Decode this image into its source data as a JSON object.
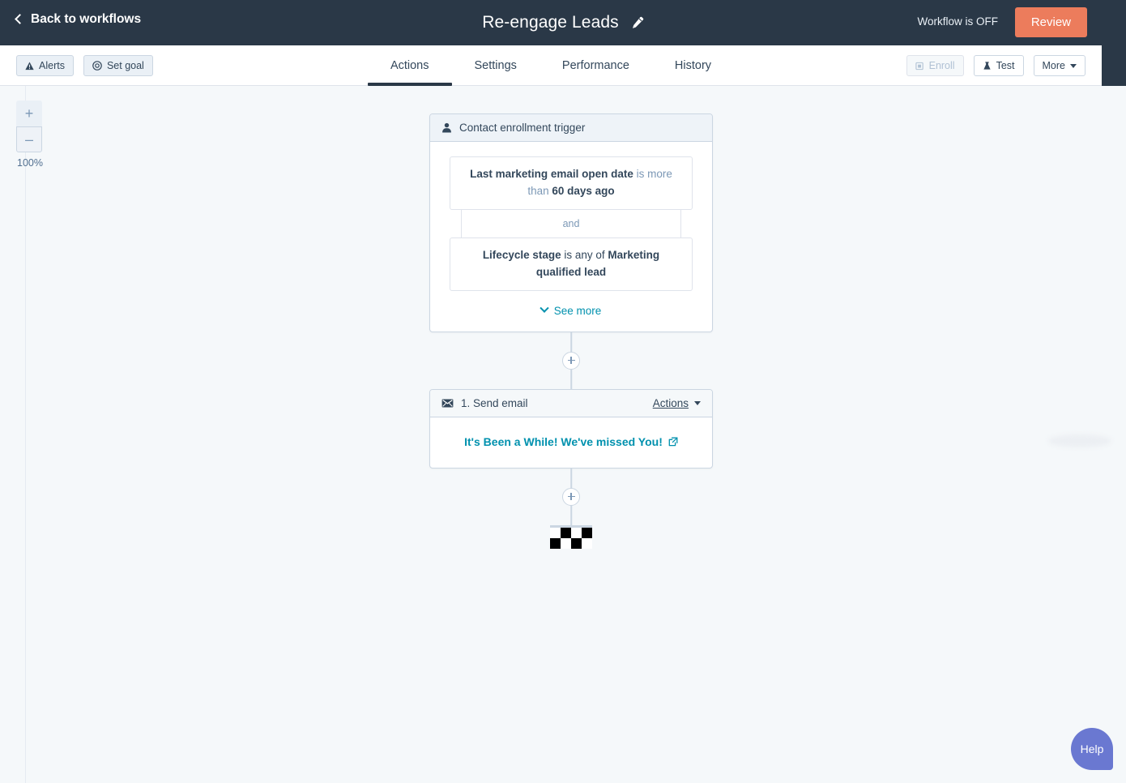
{
  "header": {
    "back_label": "Back to workflows",
    "back_icon": "chevron-left-icon",
    "title": "Re-engage Leads",
    "edit_icon": "pencil-icon",
    "workflow_state": "Workflow is OFF",
    "review_label": "Review",
    "review_color": "#ec7c5c",
    "bar_color": "#2a3847"
  },
  "toolbar": {
    "alerts_label": "Alerts",
    "alerts_icon": "warning-triangle-icon",
    "set_goal_label": "Set goal",
    "set_goal_icon": "target-icon",
    "enroll_label": "Enroll",
    "enroll_icon": "enroll-icon",
    "enroll_disabled": "true",
    "test_label": "Test",
    "test_icon": "flask-icon",
    "more_label": "More",
    "more_icon": "caret-down-icon"
  },
  "tabs": [
    {
      "label": "Actions",
      "active": true
    },
    {
      "label": "Settings",
      "active": false
    },
    {
      "label": "Performance",
      "active": false
    },
    {
      "label": "History",
      "active": false
    }
  ],
  "zoom": {
    "in_label": "+",
    "out_label": "–",
    "level": "100%"
  },
  "flow": {
    "trigger": {
      "icon": "contact-person-icon",
      "title": "Contact enrollment trigger",
      "filters": [
        {
          "property": "Last marketing email open date",
          "operator": " is more than ",
          "value": "60 days ago"
        },
        {
          "property": "Lifecycle stage",
          "operator": " is any of ",
          "value": "Marketing qualified lead"
        }
      ],
      "join_label": "and",
      "see_more_label": "See more",
      "see_more_icon": "chevron-down-icon"
    },
    "add_step_icon": "plus-circle-icon",
    "action": {
      "icon": "envelope-icon",
      "title": "1. Send email",
      "actions_label": "Actions",
      "actions_caret_icon": "caret-down-icon",
      "email_name": "It's Been a While! We've missed You!",
      "email_external_icon": "external-link-icon"
    },
    "end_marker": "checkered-flag-icon"
  },
  "help": {
    "label": "Help",
    "color": "#6a78d1"
  }
}
